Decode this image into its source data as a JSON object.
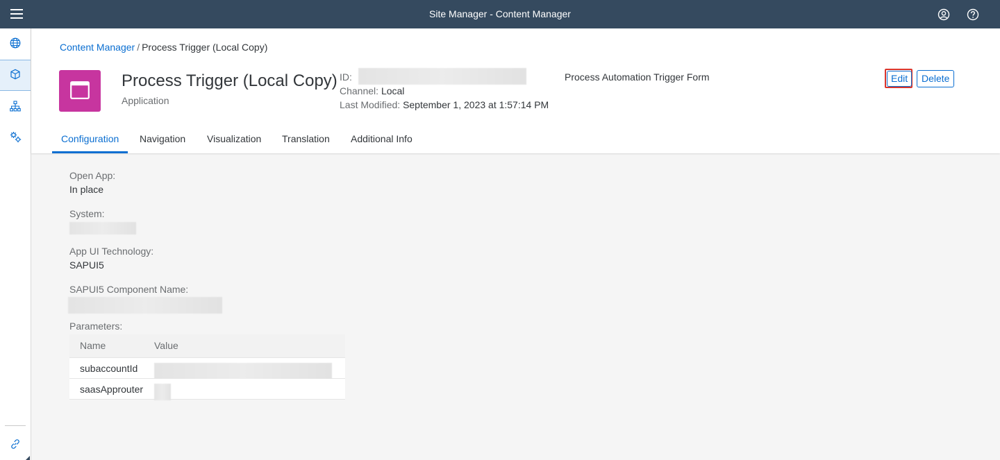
{
  "shell": {
    "title": "Site Manager - Content Manager"
  },
  "sidenav": {
    "items": [
      {
        "icon": "globe-icon"
      },
      {
        "icon": "cube-icon",
        "selected": true
      },
      {
        "icon": "hierarchy-icon"
      },
      {
        "icon": "settings-gears-icon"
      }
    ],
    "bottom_icon": "link-icon"
  },
  "breadcrumb": {
    "link": "Content Manager",
    "separator": "/",
    "current": "Process Trigger (Local Copy)"
  },
  "object": {
    "title": "Process Trigger (Local Copy)",
    "subtitle": "Application",
    "id_label": "ID:",
    "channel_label": "Channel:",
    "channel_value": "Local",
    "modified_label": "Last Modified:",
    "modified_value": "September 1, 2023 at 1:57:14 PM",
    "description": "Process Automation Trigger Form"
  },
  "actions": {
    "edit": "Edit",
    "delete": "Delete"
  },
  "tabs": [
    {
      "label": "Configuration",
      "active": true
    },
    {
      "label": "Navigation"
    },
    {
      "label": "Visualization"
    },
    {
      "label": "Translation"
    },
    {
      "label": "Additional Info"
    }
  ],
  "config": {
    "open_app_label": "Open App:",
    "open_app_value": "In place",
    "system_label": "System:",
    "ui_tech_label": "App UI Technology:",
    "ui_tech_value": "SAPUI5",
    "component_label": "SAPUI5 Component Name:",
    "parameters_label": "Parameters:",
    "table": {
      "headers": [
        "Name",
        "Value"
      ],
      "rows": [
        {
          "name": "subaccountId"
        },
        {
          "name": "saasApprouter"
        }
      ]
    }
  },
  "colors": {
    "shell": "#354a5f",
    "accent": "#0a6ed1",
    "tile": "#c7359f",
    "highlight": "#d9342b"
  }
}
